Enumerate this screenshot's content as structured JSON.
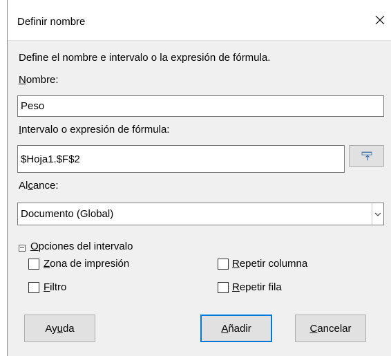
{
  "dialog": {
    "title": "Definir nombre",
    "description": "Define el nombre e intervalo o la expresión de fórmula."
  },
  "name": {
    "label_accel": "N",
    "label_rest": "ombre:",
    "value": "Peso"
  },
  "range": {
    "label_accel": "I",
    "label_rest": "ntervalo o expresión de fórmula:",
    "value": "$Hoja1.$F$2"
  },
  "scope": {
    "label_pre": "Al",
    "label_accel": "c",
    "label_rest": "ance:",
    "selected": "Documento (Global)"
  },
  "options": {
    "header_accel": "O",
    "header_rest": "pciones del intervalo",
    "print_range": {
      "accel": "Z",
      "rest": "ona de impresión",
      "checked": false
    },
    "filter": {
      "accel": "F",
      "rest": "iltro",
      "checked": false
    },
    "repeat_column": {
      "accel": "R",
      "rest": "epetir columna",
      "checked": false
    },
    "repeat_row": {
      "accel": "R",
      "rest": "epetir fila",
      "checked": false
    }
  },
  "buttons": {
    "help_pre": "Ay",
    "help_accel": "u",
    "help_rest": "da",
    "add_accel": "A",
    "add_rest": "ñadir",
    "cancel_accel": "C",
    "cancel_rest": "ancelar"
  }
}
